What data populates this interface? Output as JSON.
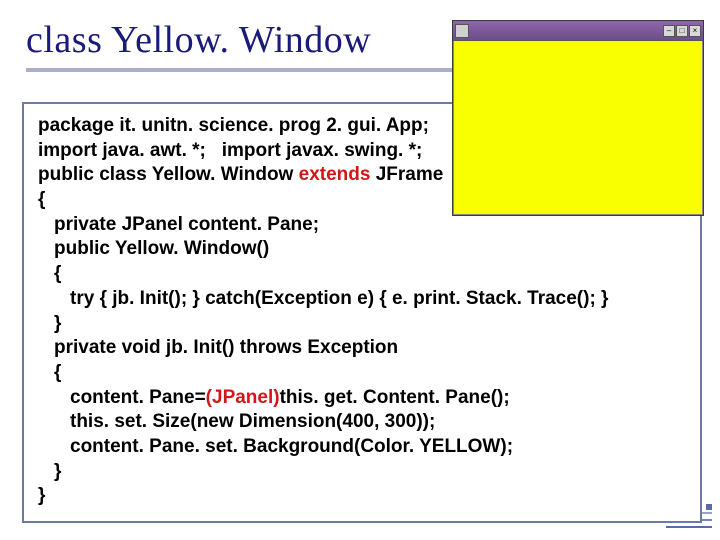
{
  "title": "class Yellow. Window",
  "mini_window": {
    "buttons": [
      "–",
      "□",
      "×"
    ]
  },
  "code": {
    "l1": "package it. unitn. science. prog 2. gui. App;",
    "l2a": "import java. awt. *;",
    "l2b": "import javax. swing. *;",
    "l3a": "public class Yellow. Window ",
    "l3b": "extends",
    "l3c": " JFrame",
    "l4": "{",
    "l5": "private JPanel content. Pane;",
    "l6": "public Yellow. Window()",
    "l7": "{",
    "l8": "try  {  jb. Init();  }   catch(Exception e) { e. print. Stack. Trace(); }",
    "l9": "}",
    "l10": "private void jb. Init() throws Exception",
    "l11": "{",
    "l12a": "content. Pane=",
    "l12b": "(JPanel)",
    "l12c": "this. get. Content. Pane();",
    "l13": "this. set. Size(new Dimension(400, 300));",
    "l14": "content. Pane. set. Background(Color. YELLOW);",
    "l15": "}",
    "l16": "}"
  }
}
